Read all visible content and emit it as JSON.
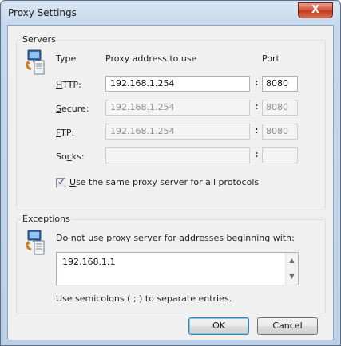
{
  "window": {
    "title": "Proxy Settings",
    "close_glyph": "X"
  },
  "servers": {
    "legend": "Servers",
    "icon": "network-computer-icon",
    "headers": {
      "type": "Type",
      "address": "Proxy address to use",
      "port": "Port"
    },
    "rows": [
      {
        "label_prefix": "",
        "label_key": "H",
        "label_rest": "TTP:",
        "address": "192.168.1.254",
        "port": "8080",
        "enabled": true
      },
      {
        "label_prefix": "",
        "label_key": "S",
        "label_rest": "ecure:",
        "address": "192.168.1.254",
        "port": "8080",
        "enabled": false
      },
      {
        "label_prefix": "",
        "label_key": "F",
        "label_rest": "TP:",
        "address": "192.168.1.254",
        "port": "8080",
        "enabled": false
      },
      {
        "label_prefix": "So",
        "label_key": "c",
        "label_rest": "ks:",
        "address": "",
        "port": "",
        "enabled": false
      }
    ],
    "colon": ":",
    "same_proxy": {
      "checked": true,
      "key": "U",
      "rest": "se the same proxy server for all protocols"
    }
  },
  "exceptions": {
    "legend": "Exceptions",
    "icon": "network-computer-icon",
    "prompt_before": "Do ",
    "prompt_key": "n",
    "prompt_after": "ot use proxy server for addresses beginning with:",
    "value": "192.168.1.1",
    "note": "Use semicolons ( ; ) to separate entries."
  },
  "buttons": {
    "ok": "OK",
    "cancel": "Cancel"
  }
}
